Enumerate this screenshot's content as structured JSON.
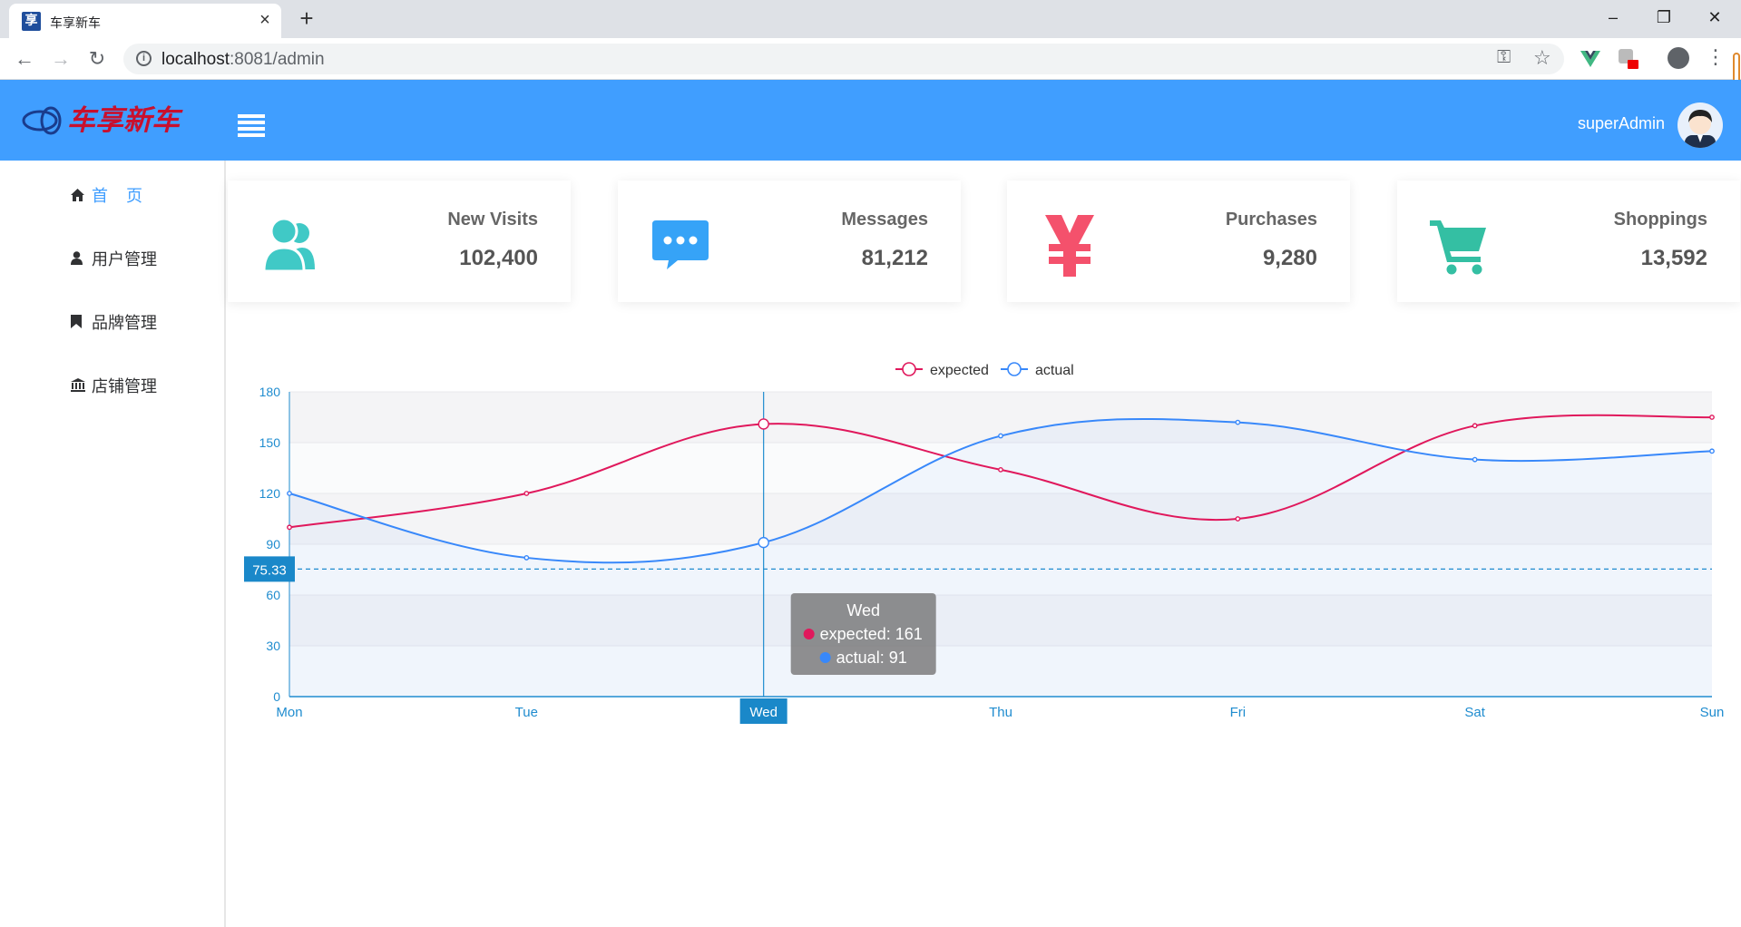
{
  "browser": {
    "tab_title": "车享新车",
    "favicon_char": "享",
    "url_host": "localhost",
    "url_path": ":8081/admin"
  },
  "header": {
    "logo_text": "车享新车",
    "user_name": "superAdmin",
    "brand_color": "#409eff"
  },
  "sidebar": {
    "items": [
      {
        "label": "首    页",
        "icon": "home-icon",
        "active": true
      },
      {
        "label": "用户管理",
        "icon": "user-icon",
        "active": false
      },
      {
        "label": "品牌管理",
        "icon": "bookmark-icon",
        "active": false
      },
      {
        "label": "店铺管理",
        "icon": "bank-icon",
        "active": false
      }
    ]
  },
  "cards": [
    {
      "label": "New Visits",
      "value": "102,400",
      "icon": "users-icon",
      "color": "#40c9c6"
    },
    {
      "label": "Messages",
      "value": "81,212",
      "icon": "message-icon",
      "color": "#36a3f7"
    },
    {
      "label": "Purchases",
      "value": "9,280",
      "icon": "yen-icon",
      "color": "#f4516c"
    },
    {
      "label": "Shoppings",
      "value": "13,592",
      "icon": "cart-icon",
      "color": "#34bfa3"
    }
  ],
  "chart_data": {
    "type": "line",
    "categories": [
      "Mon",
      "Tue",
      "Wed",
      "Thu",
      "Fri",
      "Sat",
      "Sun"
    ],
    "series": [
      {
        "name": "expected",
        "values": [
          100,
          120,
          161,
          134,
          105,
          160,
          165
        ],
        "color": "#e0185c"
      },
      {
        "name": "actual",
        "values": [
          120,
          82,
          91,
          154,
          162,
          140,
          145
        ],
        "color": "#3888fa"
      }
    ],
    "ylim": [
      0,
      180
    ],
    "yticks": [
      0,
      30,
      60,
      90,
      120,
      150,
      180
    ],
    "legend_position": "top-center",
    "pointer": {
      "category": "Wed",
      "y_readout": "75.33"
    },
    "tooltip": {
      "title": "Wed",
      "lines": [
        "expected: 161",
        "actual: 91"
      ]
    }
  }
}
